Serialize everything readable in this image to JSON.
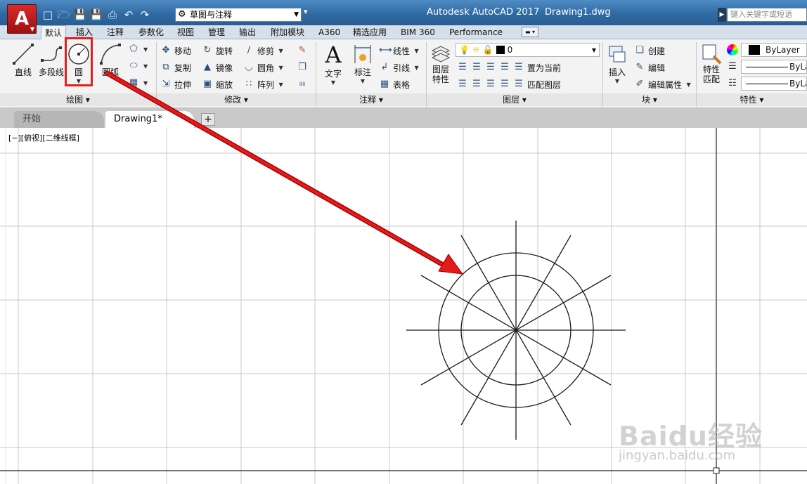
{
  "titlebar": {
    "app_title": "Autodesk AutoCAD 2017",
    "doc_title": "Drawing1.dwg",
    "app_button_letter": "A",
    "workspace": "草图与注释",
    "search_placeholder": "键入关键字或短语"
  },
  "ribbon_tabs": [
    "默认",
    "插入",
    "注释",
    "参数化",
    "视图",
    "管理",
    "输出",
    "附加模块",
    "A360",
    "精选应用",
    "BIM 360",
    "Performance"
  ],
  "active_tab": "默认",
  "draw_panel": {
    "label": "绘图",
    "line": "直线",
    "polyline": "多段线",
    "circle": "圆",
    "arc": "圆弧"
  },
  "modify_panel": {
    "label": "修改",
    "move": "移动",
    "rotate": "旋转",
    "trim": "修剪",
    "copy": "复制",
    "mirror": "镜像",
    "fillet": "圆角",
    "stretch": "拉伸",
    "scale": "缩放",
    "array": "阵列"
  },
  "annotation_panel": {
    "label": "注释",
    "text": "文字",
    "dimension": "标注",
    "linear": "线性",
    "leader": "引线",
    "table": "表格"
  },
  "layers_panel": {
    "label": "图层",
    "layer_properties_1": "图层",
    "layer_properties_2": "特性",
    "current_layer": "0",
    "set_current": "置为当前",
    "match_layer": "匹配图层"
  },
  "block_panel": {
    "label": "块",
    "insert": "插入",
    "create": "创建",
    "edit": "编辑",
    "edit_attributes": "编辑属性"
  },
  "properties_panel": {
    "label": "特性",
    "match_1": "特性",
    "match_2": "匹配",
    "color": "ByLayer",
    "linetype": "ByLa",
    "lineweight": "ByLa"
  },
  "file_tabs": {
    "start": "开始",
    "drawing": "Drawing1*",
    "add": "+"
  },
  "viewport_label": "[−][俯视][二维线框]",
  "watermark": {
    "main": "Baidu经验",
    "sub": "jingyan.baidu.com"
  },
  "colors": {
    "highlight": "#e02020",
    "arrow": "#e21b1b",
    "title_bar": "#2f6aa3"
  }
}
